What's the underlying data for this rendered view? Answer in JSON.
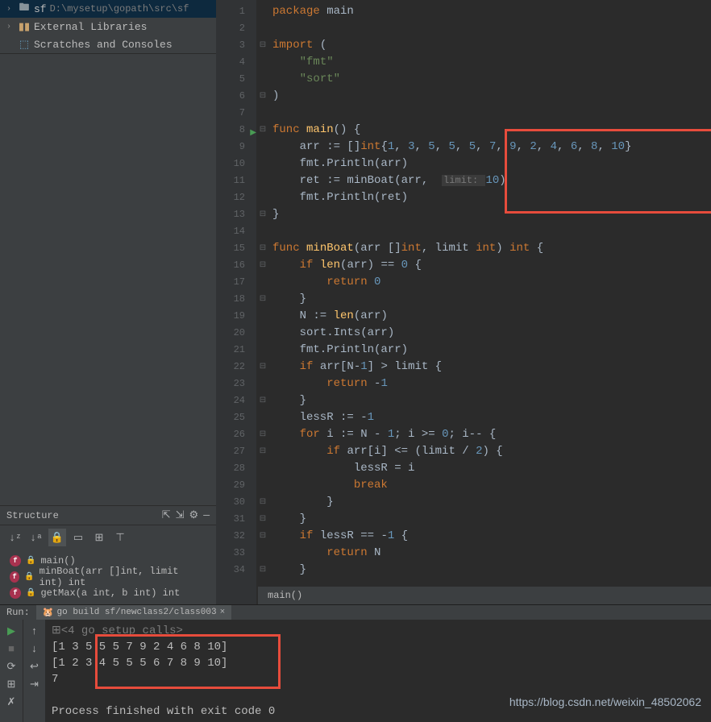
{
  "project": {
    "name": "sf",
    "path": "D:\\mysetup\\gopath\\src\\sf",
    "external_libs": "External Libraries",
    "scratches": "Scratches and Consoles"
  },
  "structure": {
    "title": "Structure",
    "items": [
      {
        "name": "main()"
      },
      {
        "name": "minBoat(arr []int, limit int) int"
      },
      {
        "name": "getMax(a int, b int) int"
      }
    ]
  },
  "code": {
    "lines": [
      {
        "n": 1,
        "fold": "",
        "segs": [
          {
            "c": "kw",
            "t": "package "
          },
          {
            "c": "id",
            "t": "main"
          }
        ]
      },
      {
        "n": 2,
        "fold": "",
        "segs": []
      },
      {
        "n": 3,
        "fold": "⊟",
        "segs": [
          {
            "c": "kw",
            "t": "import "
          },
          {
            "c": "id",
            "t": "("
          }
        ]
      },
      {
        "n": 4,
        "fold": "",
        "segs": [
          {
            "c": "id",
            "t": "    "
          },
          {
            "c": "str",
            "t": "\"fmt\""
          }
        ]
      },
      {
        "n": 5,
        "fold": "",
        "segs": [
          {
            "c": "id",
            "t": "    "
          },
          {
            "c": "str",
            "t": "\"sort\""
          }
        ]
      },
      {
        "n": 6,
        "fold": "⊟",
        "segs": [
          {
            "c": "id",
            "t": ")"
          }
        ]
      },
      {
        "n": 7,
        "fold": "",
        "segs": []
      },
      {
        "n": 8,
        "fold": "⊟",
        "play": true,
        "segs": [
          {
            "c": "kw",
            "t": "func "
          },
          {
            "c": "fn",
            "t": "main"
          },
          {
            "c": "id",
            "t": "() {"
          }
        ]
      },
      {
        "n": 9,
        "fold": "",
        "segs": [
          {
            "c": "id",
            "t": "    arr := []"
          },
          {
            "c": "kw",
            "t": "int"
          },
          {
            "c": "id",
            "t": "{"
          },
          {
            "c": "num",
            "t": "1"
          },
          {
            "c": "id",
            "t": ", "
          },
          {
            "c": "num",
            "t": "3"
          },
          {
            "c": "id",
            "t": ", "
          },
          {
            "c": "num",
            "t": "5"
          },
          {
            "c": "id",
            "t": ", "
          },
          {
            "c": "num",
            "t": "5"
          },
          {
            "c": "id",
            "t": ", "
          },
          {
            "c": "num",
            "t": "5"
          },
          {
            "c": "id",
            "t": ", "
          },
          {
            "c": "num",
            "t": "7"
          },
          {
            "c": "id",
            "t": ", "
          },
          {
            "c": "num",
            "t": "9"
          },
          {
            "c": "id",
            "t": ", "
          },
          {
            "c": "num",
            "t": "2"
          },
          {
            "c": "id",
            "t": ", "
          },
          {
            "c": "num",
            "t": "4"
          },
          {
            "c": "id",
            "t": ", "
          },
          {
            "c": "num",
            "t": "6"
          },
          {
            "c": "id",
            "t": ", "
          },
          {
            "c": "num",
            "t": "8"
          },
          {
            "c": "id",
            "t": ", "
          },
          {
            "c": "num",
            "t": "10"
          },
          {
            "c": "id",
            "t": "}"
          }
        ]
      },
      {
        "n": 10,
        "fold": "",
        "segs": [
          {
            "c": "id",
            "t": "    fmt.Println(arr)"
          }
        ]
      },
      {
        "n": 11,
        "fold": "",
        "segs": [
          {
            "c": "id",
            "t": "    ret := minBoat(arr,  "
          },
          {
            "c": "hint",
            "t": "limit: "
          },
          {
            "c": "num",
            "t": "10"
          },
          {
            "c": "id",
            "t": ")"
          }
        ]
      },
      {
        "n": 12,
        "fold": "",
        "segs": [
          {
            "c": "id",
            "t": "    fmt.Println(ret)"
          }
        ]
      },
      {
        "n": 13,
        "fold": "⊟",
        "segs": [
          {
            "c": "id",
            "t": "}"
          }
        ]
      },
      {
        "n": 14,
        "fold": "",
        "segs": []
      },
      {
        "n": 15,
        "fold": "⊟",
        "segs": [
          {
            "c": "kw",
            "t": "func "
          },
          {
            "c": "fn",
            "t": "minBoat"
          },
          {
            "c": "id",
            "t": "(arr []"
          },
          {
            "c": "kw",
            "t": "int"
          },
          {
            "c": "id",
            "t": ", limit "
          },
          {
            "c": "kw",
            "t": "int"
          },
          {
            "c": "id",
            "t": ") "
          },
          {
            "c": "kw",
            "t": "int"
          },
          {
            "c": "id",
            "t": " {"
          }
        ]
      },
      {
        "n": 16,
        "fold": "⊟",
        "segs": [
          {
            "c": "id",
            "t": "    "
          },
          {
            "c": "kw",
            "t": "if "
          },
          {
            "c": "fn",
            "t": "len"
          },
          {
            "c": "id",
            "t": "(arr) == "
          },
          {
            "c": "num",
            "t": "0"
          },
          {
            "c": "id",
            "t": " {"
          }
        ]
      },
      {
        "n": 17,
        "fold": "",
        "segs": [
          {
            "c": "id",
            "t": "        "
          },
          {
            "c": "kw",
            "t": "return "
          },
          {
            "c": "num",
            "t": "0"
          }
        ]
      },
      {
        "n": 18,
        "fold": "⊟",
        "segs": [
          {
            "c": "id",
            "t": "    }"
          }
        ]
      },
      {
        "n": 19,
        "fold": "",
        "segs": [
          {
            "c": "id",
            "t": "    N := "
          },
          {
            "c": "fn",
            "t": "len"
          },
          {
            "c": "id",
            "t": "(arr)"
          }
        ]
      },
      {
        "n": 20,
        "fold": "",
        "segs": [
          {
            "c": "id",
            "t": "    sort.Ints(arr)"
          }
        ]
      },
      {
        "n": 21,
        "fold": "",
        "segs": [
          {
            "c": "id",
            "t": "    fmt.Println(arr)"
          }
        ]
      },
      {
        "n": 22,
        "fold": "⊟",
        "segs": [
          {
            "c": "id",
            "t": "    "
          },
          {
            "c": "kw",
            "t": "if "
          },
          {
            "c": "id",
            "t": "arr[N-"
          },
          {
            "c": "num",
            "t": "1"
          },
          {
            "c": "id",
            "t": "] > limit {"
          }
        ]
      },
      {
        "n": 23,
        "fold": "",
        "segs": [
          {
            "c": "id",
            "t": "        "
          },
          {
            "c": "kw",
            "t": "return "
          },
          {
            "c": "id",
            "t": "-"
          },
          {
            "c": "num",
            "t": "1"
          }
        ]
      },
      {
        "n": 24,
        "fold": "⊟",
        "segs": [
          {
            "c": "id",
            "t": "    }"
          }
        ]
      },
      {
        "n": 25,
        "fold": "",
        "segs": [
          {
            "c": "id",
            "t": "    lessR := -"
          },
          {
            "c": "num",
            "t": "1"
          }
        ]
      },
      {
        "n": 26,
        "fold": "⊟",
        "segs": [
          {
            "c": "id",
            "t": "    "
          },
          {
            "c": "kw",
            "t": "for "
          },
          {
            "c": "id",
            "t": "i := N - "
          },
          {
            "c": "num",
            "t": "1"
          },
          {
            "c": "id",
            "t": "; i >= "
          },
          {
            "c": "num",
            "t": "0"
          },
          {
            "c": "id",
            "t": "; i-- {"
          }
        ]
      },
      {
        "n": 27,
        "fold": "⊟",
        "segs": [
          {
            "c": "id",
            "t": "        "
          },
          {
            "c": "kw",
            "t": "if "
          },
          {
            "c": "id",
            "t": "arr[i] <= (limit / "
          },
          {
            "c": "num",
            "t": "2"
          },
          {
            "c": "id",
            "t": ") {"
          }
        ]
      },
      {
        "n": 28,
        "fold": "",
        "segs": [
          {
            "c": "id",
            "t": "            lessR = i"
          }
        ]
      },
      {
        "n": 29,
        "fold": "",
        "segs": [
          {
            "c": "id",
            "t": "            "
          },
          {
            "c": "kw",
            "t": "break"
          }
        ]
      },
      {
        "n": 30,
        "fold": "⊟",
        "segs": [
          {
            "c": "id",
            "t": "        }"
          }
        ]
      },
      {
        "n": 31,
        "fold": "⊟",
        "segs": [
          {
            "c": "id",
            "t": "    }"
          }
        ]
      },
      {
        "n": 32,
        "fold": "⊟",
        "segs": [
          {
            "c": "id",
            "t": "    "
          },
          {
            "c": "kw",
            "t": "if "
          },
          {
            "c": "id",
            "t": "lessR == -"
          },
          {
            "c": "num",
            "t": "1"
          },
          {
            "c": "id",
            "t": " {"
          }
        ]
      },
      {
        "n": 33,
        "fold": "",
        "segs": [
          {
            "c": "id",
            "t": "        "
          },
          {
            "c": "kw",
            "t": "return "
          },
          {
            "c": "id",
            "t": "N"
          }
        ]
      },
      {
        "n": 34,
        "fold": "⊟",
        "segs": [
          {
            "c": "id",
            "t": "    }"
          }
        ]
      }
    ],
    "breadcrumb": "main()"
  },
  "run": {
    "label": "Run:",
    "tab": "go build sf/newclass2/class003",
    "output": [
      {
        "cls": "gray",
        "t": "⊞<4 go setup calls>"
      },
      {
        "cls": "",
        "t": "[1 3 5 5 5 7 9 2 4 6 8 10]"
      },
      {
        "cls": "",
        "t": "[1 2 3 4 5 5 5 6 7 8 9 10]"
      },
      {
        "cls": "",
        "t": "7"
      },
      {
        "cls": "",
        "t": ""
      },
      {
        "cls": "",
        "t": "Process finished with exit code 0"
      }
    ]
  },
  "watermark": "https://blog.csdn.net/weixin_48502062"
}
